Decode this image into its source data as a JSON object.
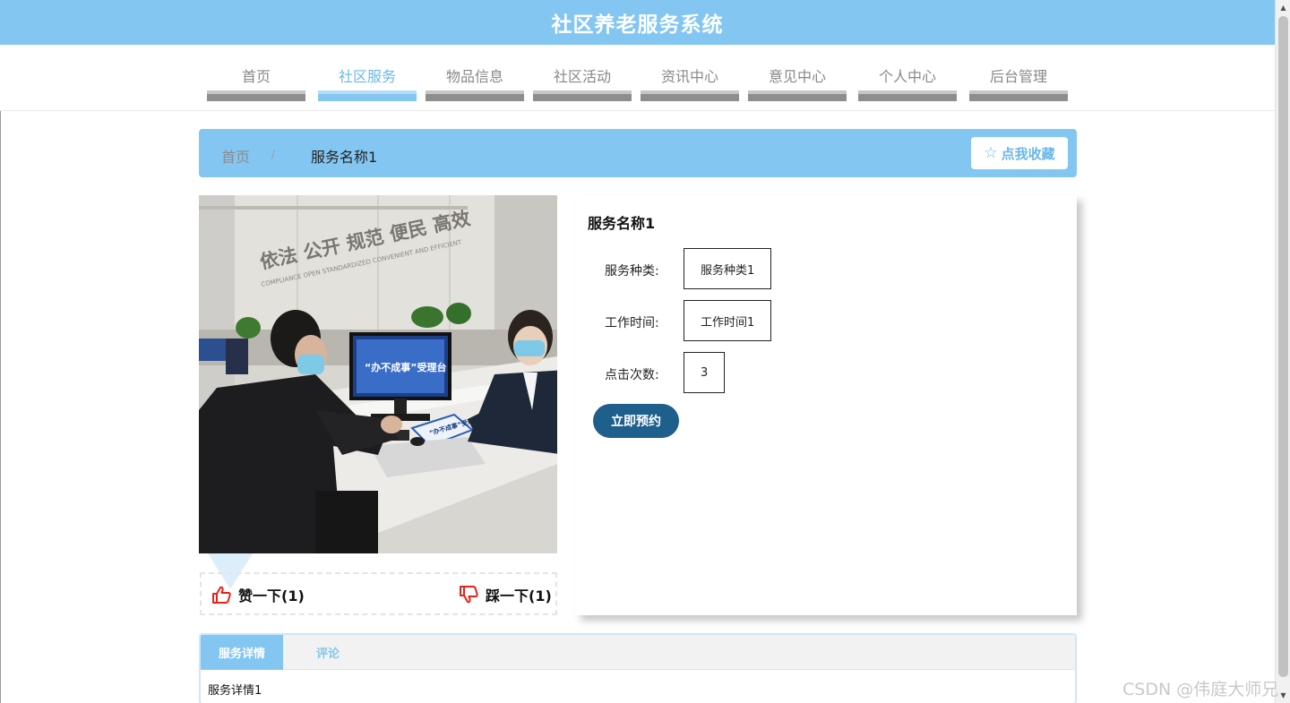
{
  "header": {
    "title": "社区养老服务系统"
  },
  "nav": {
    "items": [
      {
        "label": "首页"
      },
      {
        "label": "社区服务"
      },
      {
        "label": "物品信息"
      },
      {
        "label": "社区活动"
      },
      {
        "label": "资讯中心"
      },
      {
        "label": "意见中心"
      },
      {
        "label": "个人中心"
      },
      {
        "label": "后台管理"
      }
    ],
    "active": "社区服务"
  },
  "breadcrumb": {
    "home": "首页",
    "separator": "/",
    "current": "服务名称1"
  },
  "favorite": {
    "label": "点我收藏",
    "icon": "star-outline-icon"
  },
  "photo": {
    "sign_cn": "依法 公开 规范 便民 高效",
    "sign_en": "COMPLIANCE OPEN STANDARDIZED CONVENIENT AND EFFICIENT",
    "screen_text": "“办不成事”受理台",
    "desk_sign": "“办不成事”受理台"
  },
  "votes": {
    "like_label": "赞一下(1)",
    "dislike_label": "踩一下(1)"
  },
  "service": {
    "name": "服务名称1",
    "category_label": "服务种类:",
    "category_value": "服务种类1",
    "hours_label": "工作时间:",
    "hours_value": "工作时间1",
    "clicks_label": "点击次数:",
    "clicks_value": "3",
    "book_label": "立即预约"
  },
  "tabs": {
    "items": [
      {
        "label": "服务详情"
      },
      {
        "label": "评论"
      }
    ],
    "active": "服务详情",
    "content": "服务详情1"
  },
  "watermark": "CSDN @伟庭大师兄",
  "colors": {
    "primary": "#83c6f2",
    "primary_dark": "#1f5f8b",
    "vote_icon": "#e8211a"
  }
}
